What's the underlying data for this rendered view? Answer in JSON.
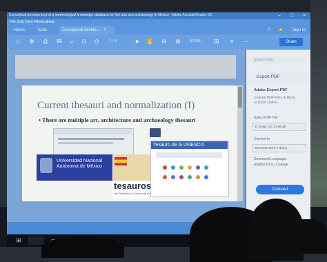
{
  "window": {
    "title": "Conceptual development of a terminological knowledge database for fine arts and archaeology in Mexico - Adobe Acrobat Reader DC",
    "controls": [
      "–",
      "□",
      "×"
    ]
  },
  "menu": [
    "File",
    "Edit",
    "View",
    "Window",
    "Help"
  ],
  "tabs": {
    "home": "Home",
    "tools": "Tools",
    "document": "Conceptual develo...",
    "close": "×"
  },
  "header_right": {
    "help": "?",
    "bell": "🔔",
    "sign_in": "Sign In"
  },
  "toolbar": {
    "page_counter": "1 / 6",
    "zoom": "90.9%",
    "share": "Share",
    "icons": [
      "save-icon",
      "print-icon",
      "email-icon",
      "search-icon",
      "page-up-icon",
      "page-down-icon",
      "cursor-icon",
      "hand-icon",
      "zoom-out-icon",
      "zoom-in-icon",
      "fit-icon",
      "comment-icon",
      "more-icon",
      "upload-icon"
    ]
  },
  "slide": {
    "title": "Current thesauri and normalization (I)",
    "bullet": "• There are multiple art, architecture and archaeology thesauri",
    "unam": "Universidad Nacional Autónoma de México",
    "tesauros": "tesauros",
    "tesauros_sub": "del Patrimonio Cultural de España",
    "unesco_title": "Tesauro de la UNESCO"
  },
  "right_pane": {
    "search_placeholder": "Search Tools",
    "export_pdf": "Export PDF",
    "adobe_export": "Adobe Export PDF",
    "desc_line1": "Convert PDF Files to Word",
    "desc_line2": "or Excel Online",
    "select_label": "Select PDF File",
    "select_value": "21 [Engl...DC 2019.pdf",
    "convert_to": "Convert to",
    "convert_value": "Microsoft Word (*.docx)",
    "language_label": "Document Language:",
    "language_value": "English (U.S.) Change",
    "convert_button": "Convert"
  },
  "taskbar": [
    "windows-icon",
    "search-icon",
    "task-view-icon",
    "edge-icon",
    "explorer-icon",
    "acrobat-icon"
  ]
}
